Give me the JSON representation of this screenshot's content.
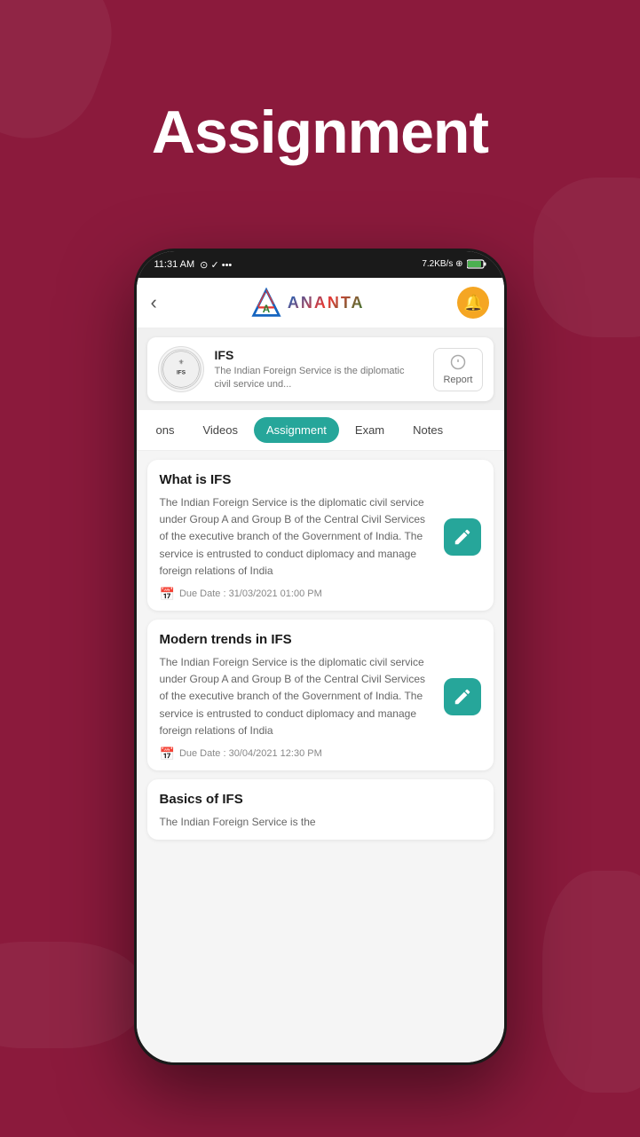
{
  "page": {
    "title": "Assignment",
    "background_color": "#8B1A3C"
  },
  "status_bar": {
    "time": "11:31 AM",
    "icons": "⊙ ✓ •••",
    "right": "7.2KB/s ⊕",
    "battery": "85"
  },
  "header": {
    "back_label": "‹",
    "logo_text": "ANANTA",
    "bell_label": "🔔"
  },
  "course": {
    "name": "IFS",
    "description": "The Indian Foreign Service is the diplomatic civil service und...",
    "report_label": "Report"
  },
  "tabs": [
    {
      "id": "ons",
      "label": "ons",
      "active": false
    },
    {
      "id": "videos",
      "label": "Videos",
      "active": false
    },
    {
      "id": "assignment",
      "label": "Assignment",
      "active": true
    },
    {
      "id": "exam",
      "label": "Exam",
      "active": false
    },
    {
      "id": "notes",
      "label": "Notes",
      "active": false
    }
  ],
  "assignments": [
    {
      "title": "What is IFS",
      "text": "The Indian Foreign Service is the diplomatic civil service under Group A and Group B of the Central Civil Services of the executive branch of the Government of India. The service is entrusted to conduct diplomacy and manage foreign relations of India",
      "due_date": "Due Date : 31/03/2021 01:00 PM"
    },
    {
      "title": "Modern trends in IFS",
      "text": "The Indian Foreign Service is the diplomatic civil service under Group A and Group B of the Central Civil Services of the executive branch of the Government of India. The service is entrusted to conduct diplomacy and manage foreign relations of India",
      "due_date": "Due Date : 30/04/2021 12:30 PM"
    },
    {
      "title": "Basics of IFS",
      "text": "The Indian Foreign Service is the",
      "due_date": ""
    }
  ],
  "icons": {
    "edit": "pencil",
    "calendar": "📅",
    "report_icon": "📊"
  }
}
